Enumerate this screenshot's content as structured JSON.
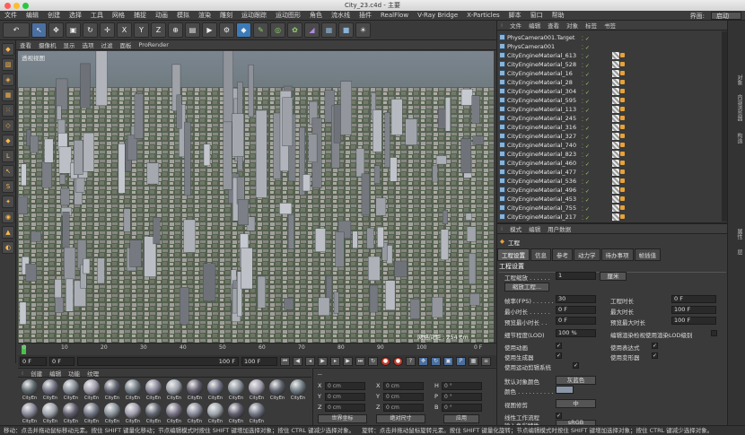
{
  "window": {
    "title": "City_23.c4d - 主要"
  },
  "menubar": {
    "items": [
      "文件",
      "编辑",
      "创建",
      "选择",
      "工具",
      "网格",
      "捕捉",
      "动画",
      "模拟",
      "渲染",
      "雕刻",
      "运动跟踪",
      "运动图形",
      "角色",
      "流水线",
      "插件",
      "RealFlow",
      "V-Ray Bridge",
      "X-Particles",
      "脚本",
      "窗口",
      "帮助"
    ],
    "layout_label": "界面:",
    "layout_value": "启动"
  },
  "toolbar": {
    "xyz": [
      "X",
      "Y",
      "Z"
    ]
  },
  "viewport": {
    "menu": [
      "查看",
      "摄像机",
      "显示",
      "选项",
      "过滤",
      "面板",
      "ProRender"
    ],
    "label": "透视视图",
    "grid_distance": "网格间距 : 254 cm"
  },
  "timeline": {
    "ticks": [
      "0",
      "10",
      "20",
      "30",
      "40",
      "50",
      "60",
      "70",
      "80",
      "90",
      "100"
    ],
    "fps_suffix": "0 F"
  },
  "frames": {
    "current": "0 F",
    "start": "0 F",
    "end": "100 F",
    "max": "100 F"
  },
  "materials": {
    "menu": [
      "创建",
      "编辑",
      "功能",
      "纹理"
    ],
    "items": [
      "CityEn",
      "CityEn",
      "CityEn",
      "CityEn",
      "CityEn",
      "CityEn",
      "CityEn",
      "CityEn",
      "CityEn",
      "CityEn",
      "CityEn",
      "CityEn",
      "CityEn",
      "CityEn",
      "CityEn",
      "CityEn",
      "CityEn",
      "CityEn",
      "CityEn",
      "CityEn",
      "CityEn",
      "CityEn",
      "CityEn",
      "CityEn",
      "CityEn",
      "CityEn"
    ]
  },
  "coords": {
    "header": "--",
    "rows": [
      {
        "a": "X",
        "av": "0 cm",
        "b": "X",
        "bv": "0 cm",
        "c": "H",
        "cv": "0 °"
      },
      {
        "a": "Y",
        "av": "0 cm",
        "b": "Y",
        "bv": "0 cm",
        "c": "P",
        "cv": "0 °"
      },
      {
        "a": "Z",
        "av": "0 cm",
        "b": "Z",
        "bv": "0 cm",
        "c": "B",
        "cv": "0 °"
      }
    ],
    "world": "世界坐标",
    "scale": "绝对尺寸",
    "apply": "应用"
  },
  "objects": {
    "menu": [
      "文件",
      "编辑",
      "查看",
      "对象",
      "标签",
      "书签"
    ],
    "rows": [
      "PhysCamera001.Target",
      "PhysCamera001",
      "CityEngineMaterial_613",
      "CityEngineMaterial_528",
      "CityEngineMaterial_16",
      "CityEngineMaterial_28",
      "CityEngineMaterial_304",
      "CityEngineMaterial_595",
      "CityEngineMaterial_113",
      "CityEngineMaterial_245",
      "CityEngineMaterial_316",
      "CityEngineMaterial_327",
      "CityEngineMaterial_740",
      "CityEngineMaterial_823",
      "CityEngineMaterial_460",
      "CityEngineMaterial_477",
      "CityEngineMaterial_536",
      "CityEngineMaterial_496",
      "CityEngineMaterial_453",
      "CityEngineMaterial_755",
      "CityEngineMaterial_217"
    ]
  },
  "attributes": {
    "menu": [
      "模式",
      "编辑",
      "用户数据"
    ],
    "title": "工程",
    "tabs": [
      "工程设置",
      "信息",
      "参考",
      "动力学",
      "待办事项",
      "帧插值"
    ],
    "section": "工程设置",
    "project_scale_label": "工程缩放 . . . . . .",
    "project_scale_value": "1",
    "project_scale_unit": "厘米",
    "scale_project_btn": "缩放工程...",
    "fps_label": "帧率(FPS) . . . . . .",
    "fps_value": "30",
    "project_time_label": "工程时长",
    "project_time_value": "0 F",
    "min_time_label": "最小时长 . . . . . .",
    "min_time_value": "0 F",
    "max_time_label": "最大时长",
    "max_time_value": "100 F",
    "preview_min_label": "预览最小时长 . .",
    "preview_min_value": "0 F",
    "preview_max_label": "预览最大时长",
    "preview_max_value": "100 F",
    "lod_label": "细节程度(LOD)",
    "lod_value": "100 %",
    "render_lod_label": "编辑渲染检视使用渲染LOD级别",
    "use_anim_label": "使用动画",
    "use_expr_label": "使用表达式",
    "use_gen_label": "使用生成器",
    "use_deform_label": "使用变形器",
    "use_motion_label": "使用运动剪辑系统",
    "default_color_label": "默认对象颜色",
    "default_color_value": "灰蓝色",
    "color_label": "颜色 . . . . . . . . . . .",
    "view_clip_label": "视图修剪",
    "view_clip_value": "中",
    "linear_label": "线性工作流程",
    "input_color_label": "输入色彩特性",
    "input_color_value": "sRGB"
  },
  "sidetabs": [
    "对象",
    "内容浏览器",
    "构造",
    "属性",
    "层"
  ],
  "status": {
    "left": "移动：点击并拖动鼠标移动元素。按住 SHIFT 键量化移动；节点编辑模式时按住 SHIFT 键增加选择对象；按住 CTRL 键减少选择对象。",
    "right": "旋转：点击并拖动鼠标旋转元素。按住 SHIFT 键量化旋转；节点编辑模式时按住 SHIFT 键增加选择对象；按住 CTRL 键减少选择对象。"
  },
  "colors": {
    "accent": "#4a6fa0",
    "record": "#c53a2b",
    "tag_orange": "#e8a23a"
  }
}
